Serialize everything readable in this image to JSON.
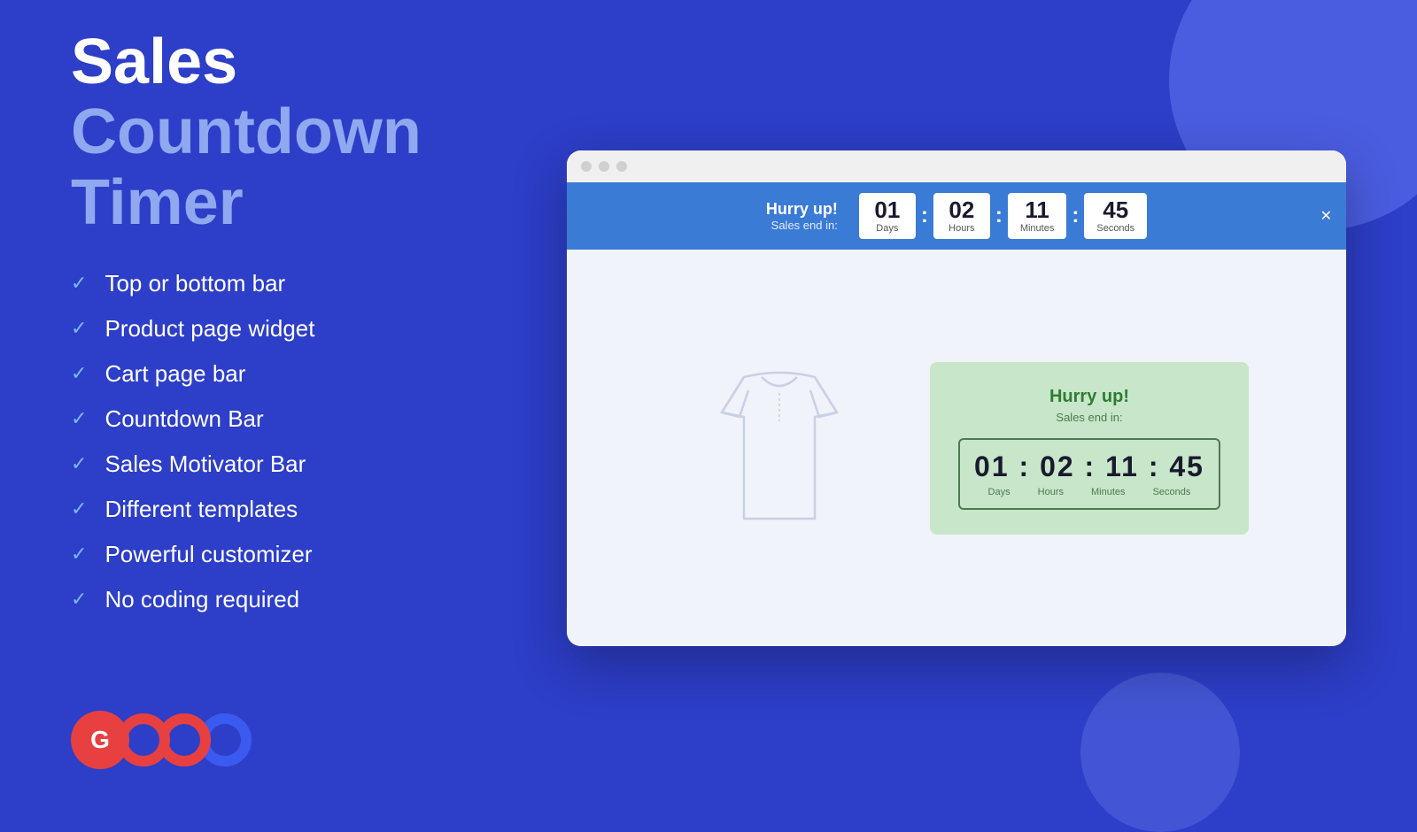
{
  "background": {
    "color": "#2d3ec8"
  },
  "title": {
    "white_part": "Sales ",
    "blue_part": "Countdown Timer"
  },
  "features": [
    {
      "id": 1,
      "label": "Top or bottom bar"
    },
    {
      "id": 2,
      "label": "Product page widget"
    },
    {
      "id": 3,
      "label": "Cart page bar"
    },
    {
      "id": 4,
      "label": "Countdown Bar"
    },
    {
      "id": 5,
      "label": "Sales Motivator Bar"
    },
    {
      "id": 6,
      "label": "Different templates"
    },
    {
      "id": 7,
      "label": "Powerful customizer"
    },
    {
      "id": 8,
      "label": "No coding required"
    }
  ],
  "countdown_bar": {
    "hurry_title": "Hurry up!",
    "hurry_subtitle": "Sales end in:",
    "days": "01",
    "hours": "02",
    "minutes": "11",
    "seconds": "45",
    "days_label": "Days",
    "hours_label": "Hours",
    "minutes_label": "Minutes",
    "seconds_label": "Seconds"
  },
  "product_widget": {
    "hurry_title": "Hurry up!",
    "hurry_subtitle": "Sales end in:",
    "timer_display": "01 : 02 : 11 : 45",
    "days_label": "Days",
    "hours_label": "Hours",
    "minutes_label": "Minutes",
    "seconds_label": "Seconds"
  },
  "browser": {
    "dots": [
      "dot1",
      "dot2",
      "dot3"
    ]
  },
  "logo": {
    "text": "G"
  }
}
